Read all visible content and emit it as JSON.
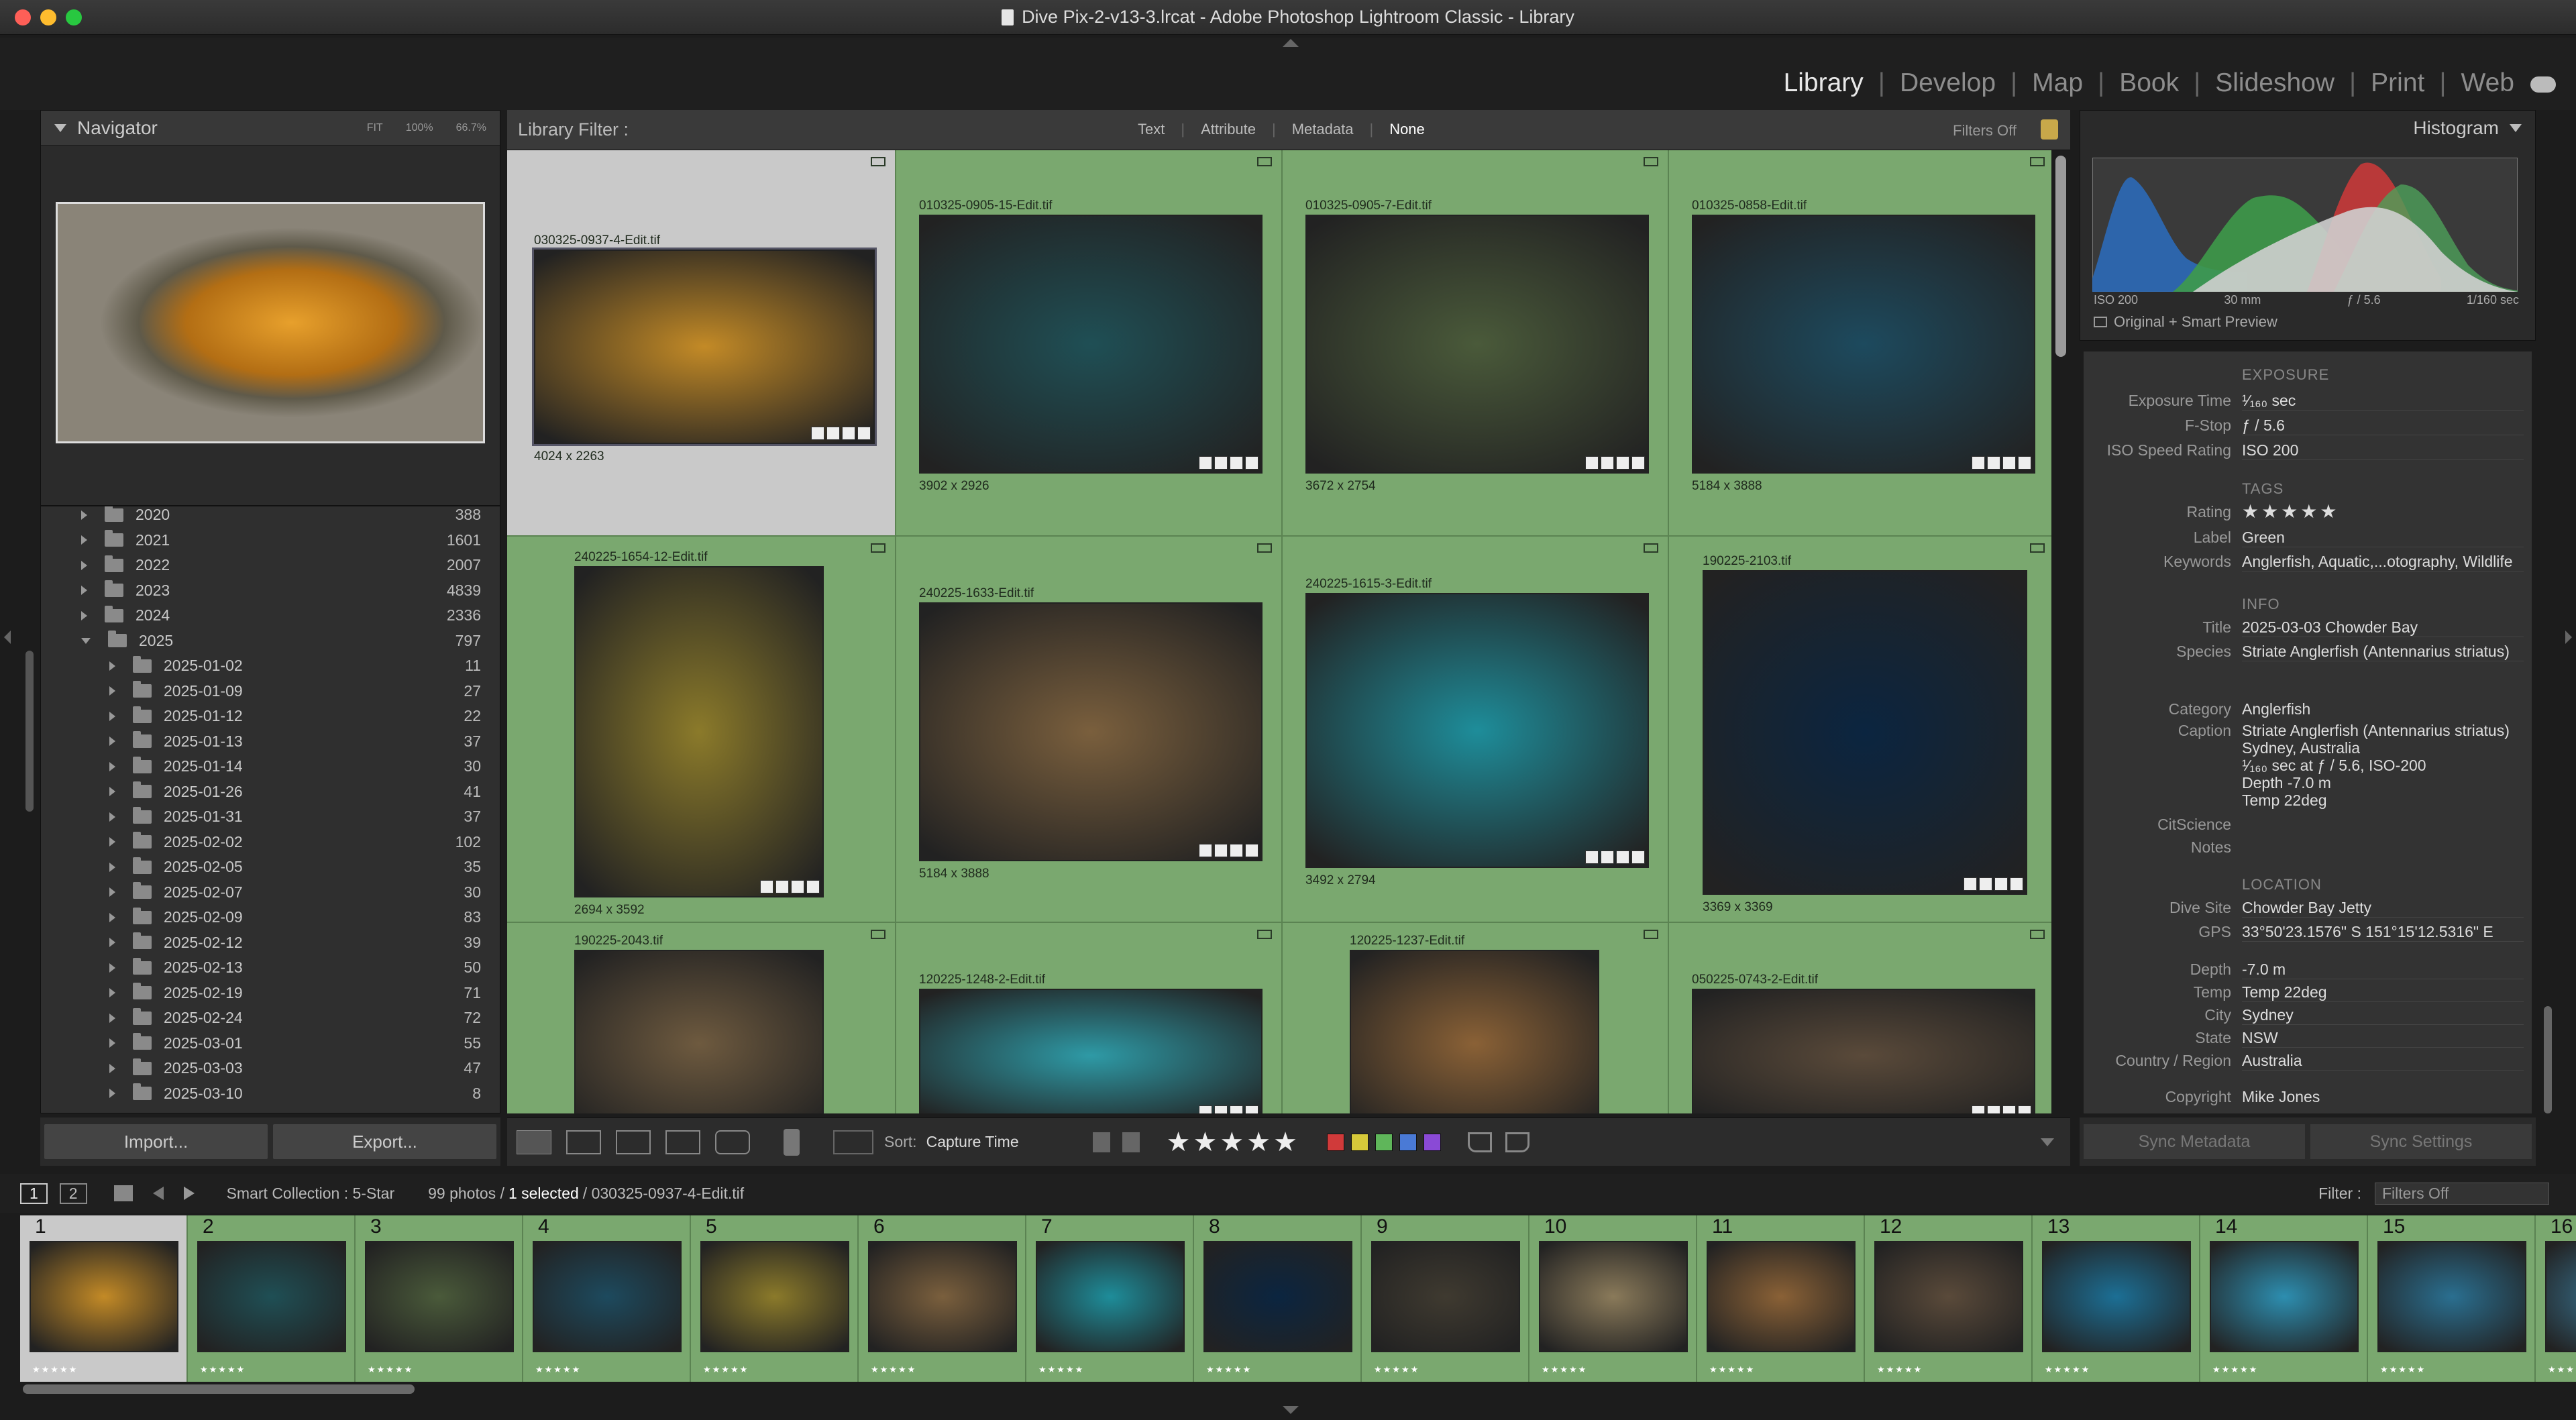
{
  "window": {
    "title": "Dive Pix-2-v13-3.lrcat - Adobe Photoshop Lightroom Classic - Library"
  },
  "modules": [
    "Library",
    "Develop",
    "Map",
    "Book",
    "Slideshow",
    "Print",
    "Web"
  ],
  "navigator": {
    "title": "Navigator",
    "zoom": [
      "FIT",
      "100%",
      "66.7%"
    ]
  },
  "folders": [
    {
      "name": "2020",
      "count": "388",
      "level": 0,
      "open": false
    },
    {
      "name": "2021",
      "count": "1601",
      "level": 0,
      "open": false
    },
    {
      "name": "2022",
      "count": "2007",
      "level": 0,
      "open": false
    },
    {
      "name": "2023",
      "count": "4839",
      "level": 0,
      "open": false
    },
    {
      "name": "2024",
      "count": "2336",
      "level": 0,
      "open": false
    },
    {
      "name": "2025",
      "count": "797",
      "level": 0,
      "open": true
    },
    {
      "name": "2025-01-02",
      "count": "11",
      "level": 1
    },
    {
      "name": "2025-01-09",
      "count": "27",
      "level": 1
    },
    {
      "name": "2025-01-12",
      "count": "22",
      "level": 1
    },
    {
      "name": "2025-01-13",
      "count": "37",
      "level": 1
    },
    {
      "name": "2025-01-14",
      "count": "30",
      "level": 1
    },
    {
      "name": "2025-01-26",
      "count": "41",
      "level": 1
    },
    {
      "name": "2025-01-31",
      "count": "37",
      "level": 1
    },
    {
      "name": "2025-02-02",
      "count": "102",
      "level": 1
    },
    {
      "name": "2025-02-05",
      "count": "35",
      "level": 1
    },
    {
      "name": "2025-02-07",
      "count": "30",
      "level": 1
    },
    {
      "name": "2025-02-09",
      "count": "83",
      "level": 1
    },
    {
      "name": "2025-02-12",
      "count": "39",
      "level": 1
    },
    {
      "name": "2025-02-13",
      "count": "50",
      "level": 1
    },
    {
      "name": "2025-02-19",
      "count": "71",
      "level": 1
    },
    {
      "name": "2025-02-24",
      "count": "72",
      "level": 1
    },
    {
      "name": "2025-03-01",
      "count": "55",
      "level": 1
    },
    {
      "name": "2025-03-03",
      "count": "47",
      "level": 1
    },
    {
      "name": "2025-03-10",
      "count": "8",
      "level": 1
    }
  ],
  "left_buttons": {
    "import": "Import...",
    "export": "Export..."
  },
  "filter_bar": {
    "label": "Library Filter :",
    "tabs": [
      "Text",
      "Attribute",
      "Metadata",
      "None"
    ],
    "filters_off": "Filters Off"
  },
  "grid": [
    {
      "file": "030325-0937-4-Edit.tif",
      "dims": "4024 x 2263",
      "color": "#c38a26"
    },
    {
      "file": "010325-0905-15-Edit.tif",
      "dims": "3902 x 2926",
      "color": "#1f4f55"
    },
    {
      "file": "010325-0905-7-Edit.tif",
      "dims": "3672 x 2754",
      "color": "#4a5a3a"
    },
    {
      "file": "010325-0858-Edit.tif",
      "dims": "5184 x 3888",
      "color": "#1d4a5e"
    },
    {
      "file": "240225-1654-12-Edit.tif",
      "dims": "2694 x 3592",
      "color": "#8b7a2a"
    },
    {
      "file": "240225-1633-Edit.tif",
      "dims": "5184 x 3888",
      "color": "#7a5f3d"
    },
    {
      "file": "240225-1615-3-Edit.tif",
      "dims": "3492 x 2794",
      "color": "#1e8d9a"
    },
    {
      "file": "190225-2103.tif",
      "dims": "3369 x 3369",
      "color": "#0b2540"
    },
    {
      "file": "190225-2043.tif",
      "dims": "",
      "color": "#6e5a3f"
    },
    {
      "file": "120225-1248-2-Edit.tif",
      "dims": "",
      "color": "#2e9aa6"
    },
    {
      "file": "120225-1237-Edit.tif",
      "dims": "",
      "color": "#8a6136"
    },
    {
      "file": "050225-0743-2-Edit.tif",
      "dims": "",
      "color": "#5a4a3a"
    }
  ],
  "toolbar": {
    "sort_label": "Sort:",
    "sort_value": "Capture Time",
    "stars": "★★★★★"
  },
  "histogram": {
    "title": "Histogram",
    "iso": "ISO 200",
    "focal": "30 mm",
    "fstop": "ƒ / 5.6",
    "shutter": "1/160 sec",
    "preview": "Original + Smart Preview"
  },
  "metadata": {
    "exposure_h": "EXPOSURE",
    "rows1": [
      [
        "Exposure Time",
        "¹⁄₁₆₀ sec"
      ],
      [
        "F-Stop",
        "ƒ / 5.6"
      ],
      [
        "ISO Speed Rating",
        "ISO 200"
      ]
    ],
    "tags_h": "TAGS",
    "rating_label": "Rating",
    "rating": "★★★★★",
    "rows2": [
      [
        "Label",
        "Green"
      ],
      [
        "Keywords",
        "Anglerfish, Aquatic,...otography, Wildlife"
      ]
    ],
    "info_h": "INFO",
    "rows3": [
      [
        "Title",
        "2025-03-03 Chowder Bay"
      ],
      [
        "Species",
        "Striate Anglerfish (Antennarius striatus)"
      ]
    ],
    "category_label": "Category",
    "category": "Anglerfish",
    "caption_label": "Caption",
    "caption": [
      "Striate Anglerfish (Antennarius striatus)",
      "Sydney, Australia",
      "¹⁄₁₆₀ sec at ƒ / 5.6, ISO-200",
      "Depth -7.0 m",
      "Temp 22deg"
    ],
    "citscience": "CitScience",
    "notes": "Notes",
    "location_h": "LOCATION",
    "rows4": [
      [
        "Dive Site",
        "Chowder Bay Jetty"
      ],
      [
        "GPS",
        "33°50'23.1576\" S 151°15'12.5316\" E"
      ]
    ],
    "rows5": [
      [
        "Depth",
        "-7.0 m"
      ],
      [
        "Temp",
        "Temp 22deg"
      ],
      [
        "City",
        "Sydney"
      ],
      [
        "State",
        "NSW"
      ],
      [
        "Country / Region",
        "Australia"
      ]
    ],
    "copyright_label": "Copyright",
    "copyright": "Mike Jones"
  },
  "sync": {
    "metadata": "Sync Metadata",
    "settings": "Sync Settings"
  },
  "filmstrip_bar": {
    "page1": "1",
    "page2": "2",
    "source": "Smart Collection : 5-Star",
    "count": "99 photos /",
    "selected": "1 selected",
    "file": "/ 030325-0937-4-Edit.tif",
    "filter_label": "Filter :",
    "filter_value": "Filters Off"
  },
  "filmstrip": [
    {
      "n": "1",
      "color": "#c38a26"
    },
    {
      "n": "2",
      "color": "#1f4f55"
    },
    {
      "n": "3",
      "color": "#4a5a3a"
    },
    {
      "n": "4",
      "color": "#1d4a5e"
    },
    {
      "n": "5",
      "color": "#8b7a2a"
    },
    {
      "n": "6",
      "color": "#7a5f3d"
    },
    {
      "n": "7",
      "color": "#1e8d9a"
    },
    {
      "n": "8",
      "color": "#0b2540"
    },
    {
      "n": "9",
      "color": "#3f3a30"
    },
    {
      "n": "10",
      "color": "#8a7a5a"
    },
    {
      "n": "11",
      "color": "#8a6136"
    },
    {
      "n": "12",
      "color": "#5a4a3a"
    },
    {
      "n": "13",
      "color": "#1c6f95"
    },
    {
      "n": "14",
      "color": "#2d8eb0"
    },
    {
      "n": "15",
      "color": "#2a6f90"
    },
    {
      "n": "16",
      "color": "#3a7a9a"
    }
  ],
  "film_stars": "★★★★★",
  "label_colors": [
    "#d03a3a",
    "#d6c93a",
    "#5fb65a",
    "#4a7ad6",
    "#8a4ad6"
  ]
}
